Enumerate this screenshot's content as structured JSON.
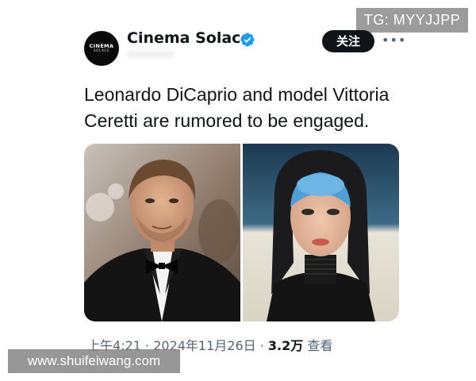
{
  "watermarks": {
    "top": "TG: MYYJJPP",
    "bottom": "www.shuifeiwang.com"
  },
  "account": {
    "name": "Cinema Solace",
    "verified": true,
    "avatar_line1": "CINEMA",
    "avatar_line2": "SOLACE"
  },
  "actions": {
    "follow_label": "关注",
    "more_icon": "more-horizontal-icon"
  },
  "tweet": {
    "text": "Leonardo DiCaprio and model Vittoria\nCeretti are rumored to be engaged."
  },
  "meta": {
    "time": "上午4:21",
    "separator": " · ",
    "date": "2024年11月26日",
    "views_count": "3.2万",
    "views_label": "查看"
  },
  "colors": {
    "text_primary": "#0f1419",
    "text_secondary": "#536471",
    "verified_blue": "#1d9bf0",
    "follow_bg": "#0f1419"
  }
}
